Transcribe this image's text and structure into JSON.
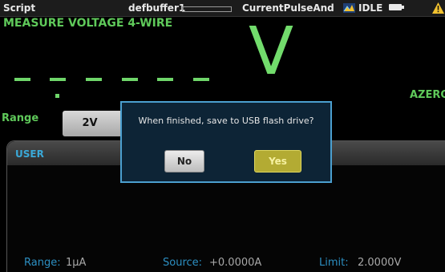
{
  "status_bar": {
    "script_label": "Script",
    "buffer_name": "defbuffer1",
    "script_name": "CurrentPulseAnd",
    "state": "IDLE"
  },
  "measure": {
    "function_label": "MEASURE VOLTAGE 4-WIRE",
    "unit": "V",
    "autozero_label": "AZERO",
    "range_label": "Range",
    "range_value": "2V"
  },
  "panel": {
    "title": "USER",
    "range_key": "Range:",
    "range_value": "1µA",
    "source_key": "Source:",
    "source_value": "+0.0000A",
    "limit_key": "Limit:",
    "limit_value": "2.0000V"
  },
  "dialog": {
    "message": "When finished, save to USB flash drive?",
    "no_label": "No",
    "yes_label": "Yes"
  },
  "icons": {
    "script": "script-running-icon",
    "battery": "battery-icon",
    "warning": "warning-icon"
  },
  "colors": {
    "measure_green": "#6fd66a",
    "dialog_border": "#4b9fcf",
    "yes_button": "#b3ab33",
    "panel_key": "#2c8fc2",
    "warning": "#f2c230"
  }
}
